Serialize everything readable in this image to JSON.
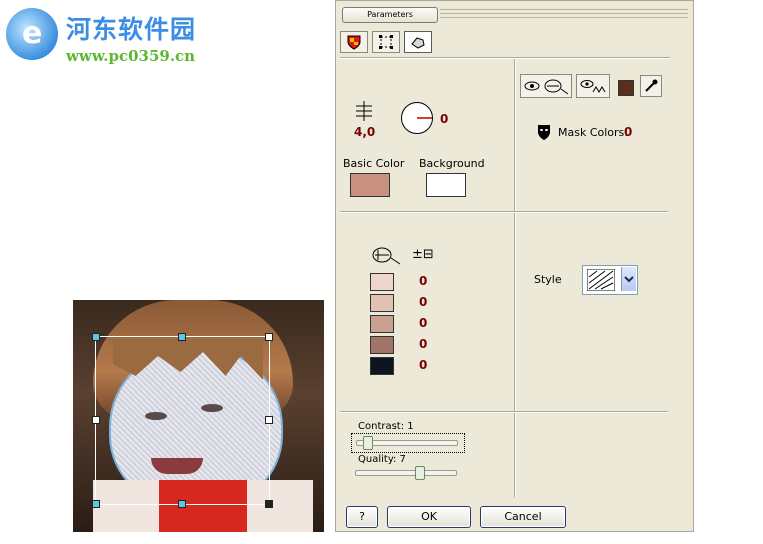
{
  "watermark": {
    "site_name": "河东软件园",
    "url": "www.pc0359.cn"
  },
  "toolbar": {
    "tab_label": "Parameters",
    "icons": [
      "shield-icon",
      "selection-icon",
      "eraser-icon"
    ]
  },
  "left_panel": {
    "spacing_value": "4,0",
    "angle_value": "0",
    "basic_color_label": "Basic Color",
    "background_label": "Background",
    "basic_color": "#c89080",
    "background_color": "#ffffff"
  },
  "right_panel": {
    "mask_colors_label": "Mask Colors:",
    "mask_colors_value": "0",
    "color_swatch": "#5a2e1a"
  },
  "tones": {
    "pm_label": "±⊟",
    "items": [
      {
        "color": "#ecd6ce",
        "value": "0"
      },
      {
        "color": "#e2c0b2",
        "value": "0"
      },
      {
        "color": "#caa090",
        "value": "0"
      },
      {
        "color": "#a27468",
        "value": "0"
      },
      {
        "color": "#0e1420",
        "value": "0"
      }
    ]
  },
  "style": {
    "label": "Style"
  },
  "sliders": {
    "contrast_label": "Contrast: 1",
    "contrast_value": 0.08,
    "quality_label": "Quality: 7",
    "quality_value": 0.65
  },
  "buttons": {
    "help": "?",
    "ok": "OK",
    "cancel": "Cancel"
  }
}
